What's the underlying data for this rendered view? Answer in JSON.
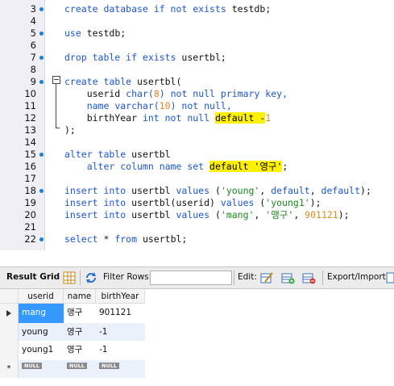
{
  "editor": {
    "lines": [
      {
        "n": "3",
        "tokens": [
          {
            "t": "create database if not exists ",
            "c": "kw"
          },
          {
            "t": "testdb;",
            "c": "plain"
          }
        ]
      },
      {
        "n": "4",
        "tokens": []
      },
      {
        "n": "5",
        "tokens": [
          {
            "t": "use ",
            "c": "kw"
          },
          {
            "t": "testdb;",
            "c": "plain"
          }
        ]
      },
      {
        "n": "6",
        "tokens": []
      },
      {
        "n": "7",
        "tokens": [
          {
            "t": "drop table if exists ",
            "c": "kw"
          },
          {
            "t": "usertbl;",
            "c": "plain"
          }
        ]
      },
      {
        "n": "8",
        "tokens": []
      },
      {
        "n": "9",
        "tokens": [
          {
            "t": "create table ",
            "c": "kw"
          },
          {
            "t": "usertbl(",
            "c": "plain"
          }
        ]
      },
      {
        "n": "10",
        "tokens": [
          {
            "t": "    userid ",
            "c": "plain"
          },
          {
            "t": "char",
            "c": "kw"
          },
          {
            "t": "(",
            "c": "kw"
          },
          {
            "t": "8",
            "c": "num"
          },
          {
            "t": ") not null primary key,",
            "c": "kw"
          }
        ]
      },
      {
        "n": "11",
        "tokens": [
          {
            "t": "    name ",
            "c": "kw"
          },
          {
            "t": "varchar",
            "c": "kw"
          },
          {
            "t": "(",
            "c": "kw"
          },
          {
            "t": "10",
            "c": "num"
          },
          {
            "t": ") not null,",
            "c": "kw"
          }
        ]
      },
      {
        "n": "12",
        "tokens": [
          {
            "t": "    birthYear ",
            "c": "plain"
          },
          {
            "t": "int not null ",
            "c": "kw"
          },
          {
            "t": "default -",
            "c": "hl"
          },
          {
            "t": "1",
            "c": "num"
          }
        ]
      },
      {
        "n": "13",
        "tokens": [
          {
            "t": ");",
            "c": "plain"
          }
        ]
      },
      {
        "n": "14",
        "tokens": []
      },
      {
        "n": "15",
        "tokens": [
          {
            "t": "alter table ",
            "c": "kw"
          },
          {
            "t": "usertbl",
            "c": "plain"
          }
        ]
      },
      {
        "n": "16",
        "tokens": [
          {
            "t": "    alter column name set ",
            "c": "kw"
          },
          {
            "t": "default '영구'",
            "c": "hl"
          },
          {
            "t": ";",
            "c": "plain"
          }
        ]
      },
      {
        "n": "17",
        "tokens": []
      },
      {
        "n": "18",
        "tokens": [
          {
            "t": "insert into ",
            "c": "kw"
          },
          {
            "t": "usertbl ",
            "c": "plain"
          },
          {
            "t": "values ",
            "c": "kw"
          },
          {
            "t": "(",
            "c": "plain"
          },
          {
            "t": "'young'",
            "c": "str"
          },
          {
            "t": ", ",
            "c": "plain"
          },
          {
            "t": "default",
            "c": "kw"
          },
          {
            "t": ", ",
            "c": "plain"
          },
          {
            "t": "default",
            "c": "kw"
          },
          {
            "t": ");",
            "c": "plain"
          }
        ]
      },
      {
        "n": "19",
        "tokens": [
          {
            "t": "insert into ",
            "c": "kw"
          },
          {
            "t": "usertbl(userid) ",
            "c": "plain"
          },
          {
            "t": "values ",
            "c": "kw"
          },
          {
            "t": "(",
            "c": "plain"
          },
          {
            "t": "'young1'",
            "c": "str"
          },
          {
            "t": ");",
            "c": "plain"
          }
        ]
      },
      {
        "n": "20",
        "tokens": [
          {
            "t": "insert into ",
            "c": "kw"
          },
          {
            "t": "usertbl ",
            "c": "plain"
          },
          {
            "t": "values ",
            "c": "kw"
          },
          {
            "t": "(",
            "c": "plain"
          },
          {
            "t": "'mang'",
            "c": "str"
          },
          {
            "t": ", ",
            "c": "plain"
          },
          {
            "t": "'맹구'",
            "c": "str"
          },
          {
            "t": ", ",
            "c": "plain"
          },
          {
            "t": "901121",
            "c": "num"
          },
          {
            "t": ");",
            "c": "plain"
          }
        ]
      },
      {
        "n": "21",
        "tokens": []
      },
      {
        "n": "22",
        "tokens": [
          {
            "t": "select ",
            "c": "kw"
          },
          {
            "t": "* ",
            "c": "plain"
          },
          {
            "t": "from ",
            "c": "kw"
          },
          {
            "t": "usertbl;",
            "c": "plain"
          }
        ]
      }
    ]
  },
  "toolbar": {
    "result_grid_label": "Result Grid",
    "filter_rows_label": "Filter Rows:",
    "filter_rows_value": "",
    "edit_label": "Edit:",
    "export_import_label": "Export/Import:"
  },
  "grid": {
    "columns": [
      "userid",
      "name",
      "birthYear"
    ],
    "rows": [
      [
        "mang",
        "맹구",
        "901121"
      ],
      [
        "young",
        "영구",
        "-1"
      ],
      [
        "young1",
        "영구",
        "-1"
      ]
    ],
    "new_row": [
      "NULL",
      "NULL",
      "NULL"
    ],
    "new_row_marker": "*",
    "selected_color": "#3399ff"
  }
}
